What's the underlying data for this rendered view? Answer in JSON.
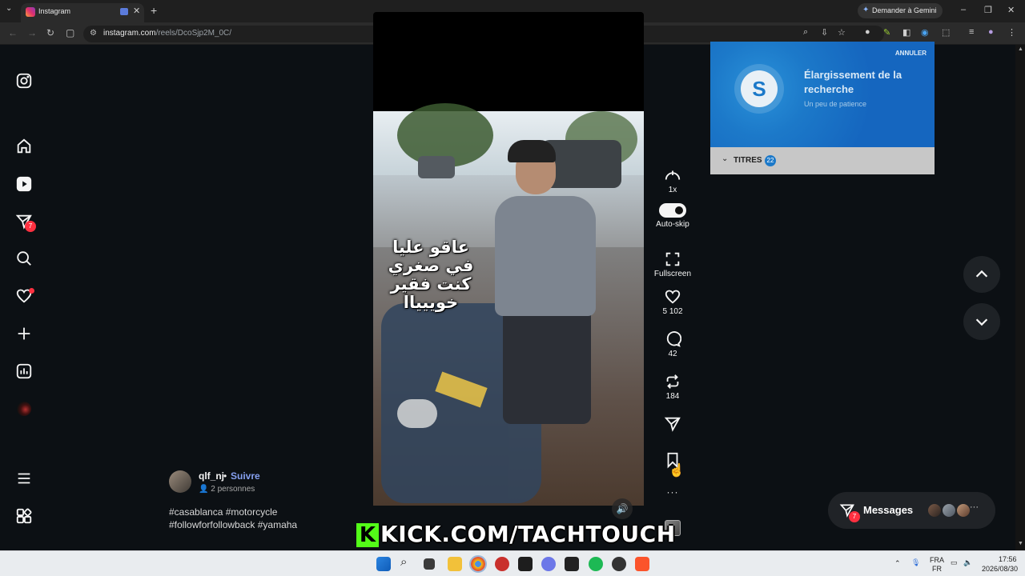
{
  "browser": {
    "tab_title": "Instagram",
    "tab_close": "✕",
    "new_tab": "+",
    "tab_menu": "⌄",
    "gemini_label": "Demander à Gemini",
    "url_domain": "instagram.com",
    "url_path": "/reels/DcoSjp2M_0C/",
    "window_controls": [
      "–",
      "❐",
      "✕"
    ]
  },
  "sidebar": {
    "messages_badge": "7"
  },
  "video": {
    "overlay_lines": [
      "عاقو عليا",
      "في صغري",
      "كنت فقير",
      "خوييياا"
    ]
  },
  "actions": {
    "speed": "1x",
    "autoskip": "Auto-skip",
    "fullscreen": "Fullscreen",
    "likes": "5 102",
    "comments": "42",
    "reposts": "184",
    "more": "···"
  },
  "shazam": {
    "cancel": "ANNULER",
    "heading": "Élargissement de la recherche",
    "subtitle": "Un peu de patience",
    "titles_label": "TITRES",
    "titles_count": "22",
    "logo": "S"
  },
  "author": {
    "username": "qlf_nj",
    "separator": "•",
    "follow": "Suivre",
    "people": "2 personnes"
  },
  "caption": {
    "line1": "#casablanca #motorcycle",
    "line2": "#followforfollowback #yamaha"
  },
  "messages": {
    "label": "Messages",
    "badge": "7",
    "more": "···"
  },
  "banner": {
    "k": "K",
    "text": "KICK.COM/TACHTOUCH"
  },
  "taskbar": {
    "lang_top": "FRA",
    "lang_bottom": "FR",
    "time": "17:56",
    "date": "2026/08/30"
  },
  "colors": {
    "page_bg": "#0c1014",
    "follow_link": "#86a0f0",
    "badge": "#ff3040",
    "shazam_blue": "#1c79c9",
    "kick_green": "#53fc18"
  }
}
